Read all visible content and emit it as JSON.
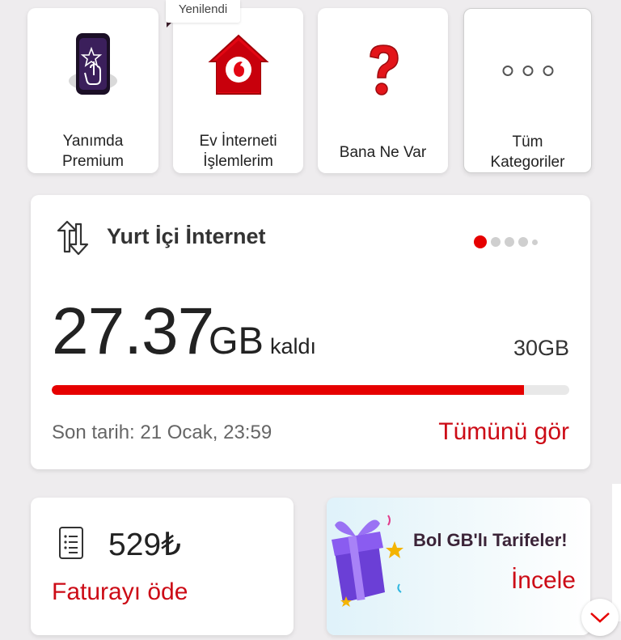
{
  "tooltip": {
    "text": "Yenilendi"
  },
  "shortcuts": [
    {
      "line1": "Yanımda",
      "line2": "Premium",
      "icon": "premium-phone-icon"
    },
    {
      "line1": "Ev İnterneti",
      "line2": "İşlemlerim",
      "icon": "home-internet-icon"
    },
    {
      "line1": "Bana Ne Var",
      "icon": "question-mark-icon"
    },
    {
      "line1": "Tüm",
      "line2": "Kategoriler",
      "icon": "more-dots-icon"
    }
  ],
  "internet": {
    "title": "Yurt İçi İnternet",
    "remaining_value": "27.37",
    "remaining_unit": "GB",
    "remaining_suffix": "kaldı",
    "total": "30GB",
    "remaining_fraction": 0.912,
    "deadline": "Son tarih: 21 Ocak, 23:59",
    "see_all": "Tümünü gör",
    "pager_active_index": 0,
    "pager_count": 5
  },
  "bill": {
    "amount": "529₺",
    "action": "Faturayı öde"
  },
  "promo": {
    "title": "Bol GB'lı Tarifeler!",
    "cta": "İncele"
  },
  "colors": {
    "accent": "#e60000",
    "link": "#cc0b16",
    "background": "#eeecee"
  }
}
